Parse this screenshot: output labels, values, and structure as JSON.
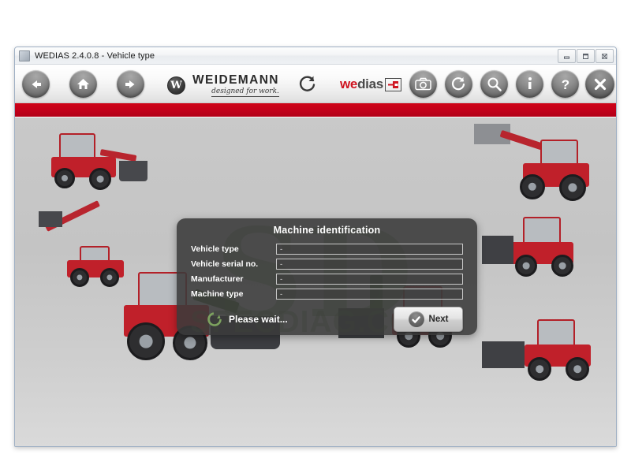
{
  "window": {
    "title": "WEDIAS 2.4.0.8 - Vehicle type",
    "controls": {
      "minimize": "—",
      "maximize": "❐",
      "close": "✕"
    }
  },
  "toolbar": {
    "back_label": "back-arrow",
    "home_label": "home",
    "forward_label": "forward-arrow",
    "refresh_label": "refresh",
    "camera_label": "camera",
    "sync_label": "sync",
    "search_label": "search",
    "info_label": "info",
    "help_label": "help",
    "close_label": "close",
    "brand": {
      "mark": "W",
      "name": "WEIDEMANN",
      "tagline": "designed for work."
    },
    "product_logo": {
      "part1": "we",
      "part2": "dias"
    }
  },
  "theme": {
    "accent_red": "#c2001a",
    "dialog_bg": "#3a3a3a",
    "watermark_green": "#4a7a36",
    "content_bg": "#c9c9c9"
  },
  "dialog": {
    "title": "Machine identification",
    "fields": [
      {
        "label": "Vehicle type",
        "value": "-"
      },
      {
        "label": "Vehicle serial no.",
        "value": "-"
      },
      {
        "label": "Manufacturer",
        "value": "-"
      },
      {
        "label": "Machine type",
        "value": "-"
      }
    ],
    "status_text": "Please wait...",
    "next_label": "Next"
  },
  "watermark": {
    "logo": "SD",
    "text": "SPECDIAG.COM"
  }
}
